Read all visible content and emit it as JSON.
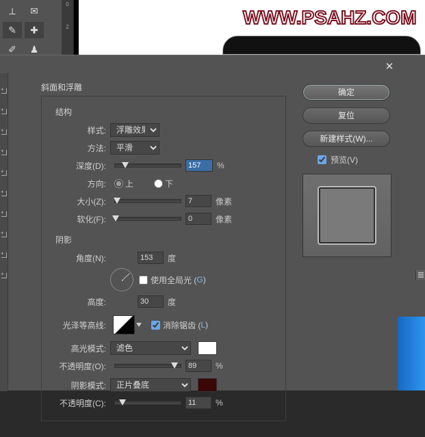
{
  "watermark": "WWW.PSAHZ.COM",
  "ruler_vals": [
    "0",
    "2"
  ],
  "tool_icons": [
    "crop-icon",
    "envelope-icon",
    "eyedropper-icon",
    "bandage-icon",
    "brush-icon",
    "stamp-icon"
  ],
  "dialog": {
    "title": "斜面和浮雕",
    "section_structure": "结构",
    "section_shading": "阴影",
    "style_label": "样式:",
    "style_value": "浮雕效果",
    "technique_label": "方法:",
    "technique_value": "平滑",
    "depth_label": "深度(D):",
    "depth_value": "157",
    "percent": "%",
    "direction_label": "方向:",
    "dir_up": "上",
    "dir_down": "下",
    "size_label": "大小(Z):",
    "size_value": "7",
    "px": "像素",
    "soften_label": "软化(F):",
    "soften_value": "0",
    "angle_label": "角度(N):",
    "angle_value": "153",
    "deg": "度",
    "global_light_label": "使用全局光 (",
    "global_light_key": "G",
    "global_light_close": ")",
    "altitude_label": "高度:",
    "altitude_value": "30",
    "gloss_label": "光泽等高线:",
    "antialias_label": "消除锯齿 (",
    "antialias_key": "L",
    "antialias_close": ")",
    "hl_mode_label": "高光模式:",
    "hl_mode_value": "滤色",
    "hl_opacity_label": "不透明度(O):",
    "hl_opacity_value": "89",
    "sh_mode_label": "阴影模式:",
    "sh_mode_value": "正片叠底",
    "sh_opacity_label": "不透明度(C):",
    "sh_opacity_value": "11"
  },
  "buttons": {
    "ok": "确定",
    "reset": "复位",
    "new_style": "新建样式(W)...",
    "preview": "预览(V)"
  }
}
